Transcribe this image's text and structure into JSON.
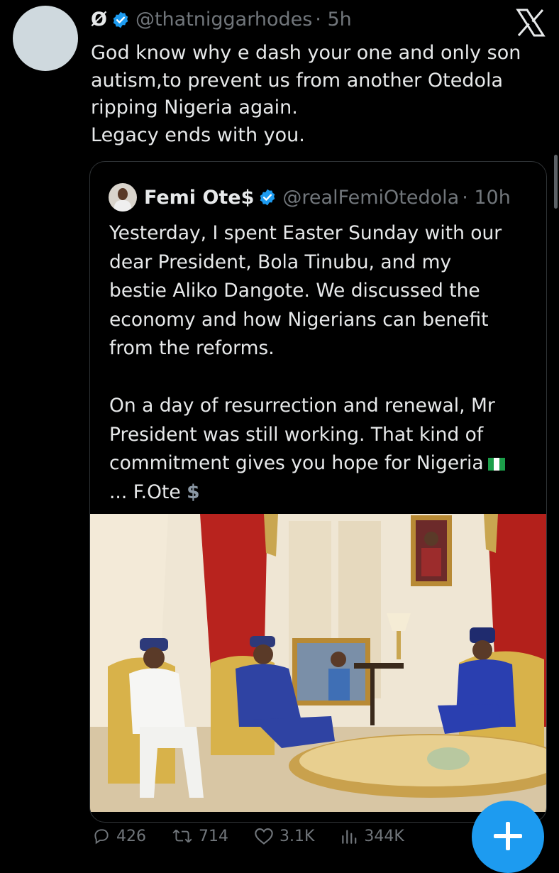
{
  "tweet": {
    "display_name": "Ø",
    "handle": "@thatniggarhodes",
    "time": "· 5h",
    "text": "God know why e dash your one and only son\nautism,to prevent us from another Otedola\nripping Nigeria again.\nLegacy ends with you."
  },
  "quote": {
    "display_name": "Femi Ote$",
    "handle": "@realFemiOtedola",
    "time": "· 10h",
    "text": "Yesterday, I spent Easter Sunday with our\ndear President, Bola Tinubu, and my\nbestie Aliko Dangote. We discussed the\neconomy and how Nigerians can benefit\nfrom the reforms.\n\nOn a day of resurrection and renewal, Mr\nPresident was still working. That kind of\ncommitment gives you hope for Nigeria",
    "signature": "... F.Ote",
    "signature_symbol": "$"
  },
  "actions": {
    "replies": "426",
    "reposts": "714",
    "likes": "3.1K",
    "views": "344K"
  },
  "colors": {
    "accent": "#1d9bf0",
    "text": "#e7e9ea",
    "muted": "#71767b",
    "background": "#000000"
  },
  "icons": [
    "verified-badge-icon",
    "x-logo-icon",
    "reply-icon",
    "repost-icon",
    "like-icon",
    "views-icon",
    "compose-plus-icon",
    "nigeria-flag-icon"
  ]
}
